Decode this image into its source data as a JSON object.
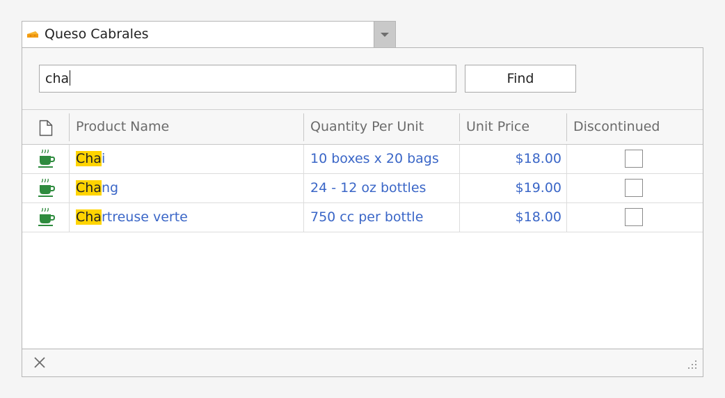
{
  "combo": {
    "selected_value": "Queso Cabrales",
    "icon": "cheese-icon",
    "dropdown_icon": "chevron-down-icon"
  },
  "search": {
    "value": "cha",
    "find_label": "Find"
  },
  "grid": {
    "header_icon": "document-icon",
    "columns": [
      "Product Name",
      "Quantity Per Unit",
      "Unit Price",
      "Discontinued"
    ],
    "rows": [
      {
        "icon": "coffee-cup-icon",
        "name_match": "Cha",
        "name_rest": "i",
        "quantity": "10 boxes x 20 bags",
        "price": "$18.00",
        "discontinued": false
      },
      {
        "icon": "coffee-cup-icon",
        "name_match": "Cha",
        "name_rest": "ng",
        "quantity": "24 - 12 oz bottles",
        "price": "$19.00",
        "discontinued": false
      },
      {
        "icon": "coffee-cup-icon",
        "name_match": "Cha",
        "name_rest": "rtreuse verte",
        "quantity": "750 cc per bottle",
        "price": "$18.00",
        "discontinued": false
      }
    ]
  },
  "footer": {
    "close_icon": "close-icon",
    "resize_icon": "resize-grip-icon"
  },
  "colors": {
    "highlight": "#ffd400",
    "link_text": "#3a66c7",
    "icon_green": "#2e8b3e",
    "cheese_orange": "#f39c12"
  }
}
